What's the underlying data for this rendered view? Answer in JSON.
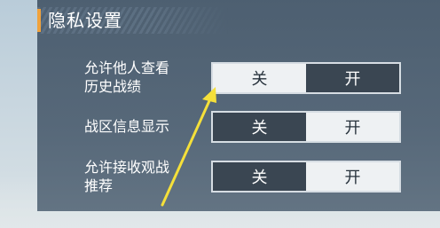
{
  "panel": {
    "title": "隐私设置",
    "accent_color": "#f0a23c"
  },
  "settings": [
    {
      "label_line1": "允许他人查看",
      "label_line2": "历史战绩",
      "options": [
        "关",
        "开"
      ],
      "selected": "关"
    },
    {
      "label_line1": "战区信息显示",
      "label_line2": "",
      "options": [
        "关",
        "开"
      ],
      "selected": "开"
    },
    {
      "label_line1": "允许接收观战",
      "label_line2": "推荐",
      "options": [
        "关",
        "开"
      ],
      "selected": "开"
    }
  ],
  "annotation": {
    "arrow_color": "#f5e03a",
    "icon": "arrow-pointer"
  }
}
